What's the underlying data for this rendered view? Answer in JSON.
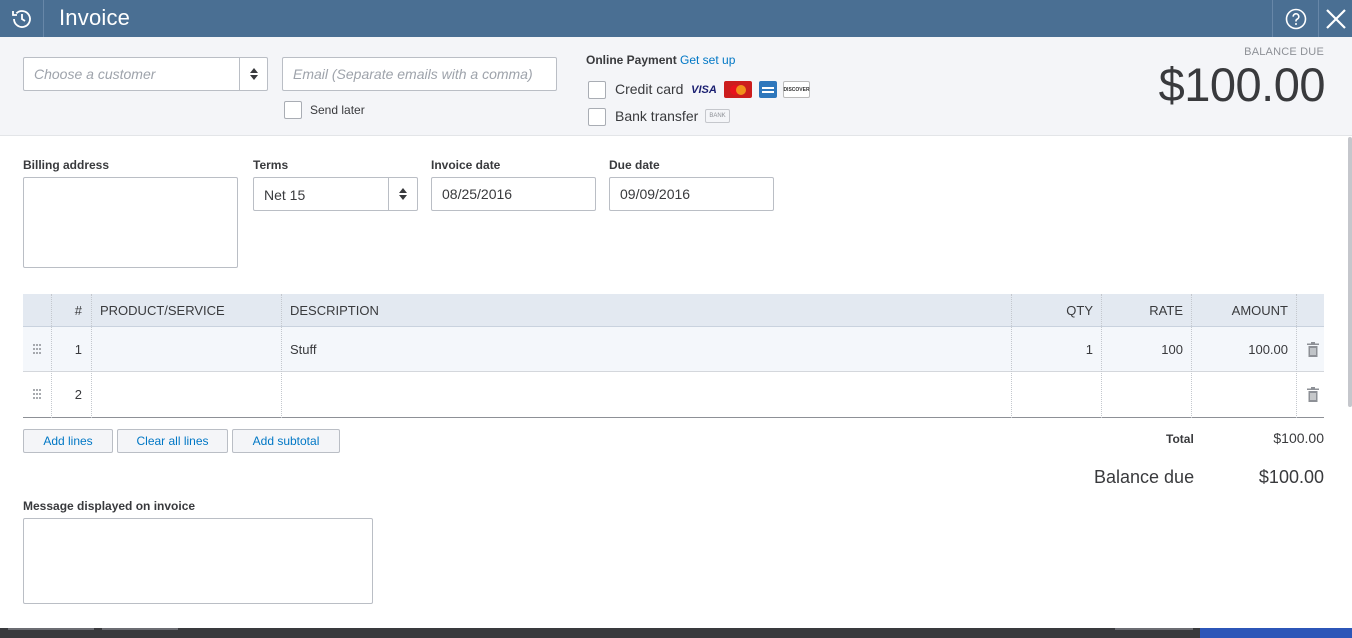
{
  "header": {
    "title": "Invoice",
    "logo_icon": "recurring-clock-icon",
    "help_icon": "help-circle-icon",
    "close_icon": "close-icon"
  },
  "customer": {
    "placeholder": "Choose a customer",
    "value": ""
  },
  "email": {
    "placeholder": "Email (Separate emails with a comma)",
    "value": "",
    "send_later_label": "Send later",
    "send_later_checked": false
  },
  "online_payment": {
    "title": "Online Payment",
    "link": "Get set up",
    "credit_card_label": "Credit card",
    "credit_card_checked": false,
    "bank_transfer_label": "Bank transfer",
    "bank_transfer_checked": false,
    "cards": [
      {
        "name": "VISA",
        "color": "#1a1f71"
      },
      {
        "name": "MasterCard",
        "color": "#eb6d1c"
      },
      {
        "name": "AMEX",
        "color": "#2e77bc"
      },
      {
        "name": "DISCOVER",
        "color": "#f47216"
      }
    ],
    "bank_badge": "BANK"
  },
  "balance": {
    "label": "BALANCE DUE",
    "amount": "$100.00"
  },
  "billing": {
    "label": "Billing address",
    "value": ""
  },
  "terms": {
    "label": "Terms",
    "value": "Net 15"
  },
  "invoice_date": {
    "label": "Invoice date",
    "value": "08/25/2016"
  },
  "due_date": {
    "label": "Due date",
    "value": "09/09/2016"
  },
  "table": {
    "headers": {
      "num": "#",
      "product": "PRODUCT/SERVICE",
      "description": "DESCRIPTION",
      "qty": "QTY",
      "rate": "RATE",
      "amount": "AMOUNT"
    },
    "rows": [
      {
        "num": "1",
        "product": "",
        "description": "Stuff",
        "qty": "1",
        "rate": "100",
        "amount": "100.00"
      },
      {
        "num": "2",
        "product": "",
        "description": "",
        "qty": "",
        "rate": "",
        "amount": ""
      }
    ]
  },
  "buttons": {
    "add_lines": "Add lines",
    "clear_all": "Clear all lines",
    "add_subtotal": "Add subtotal"
  },
  "totals": {
    "total_label": "Total",
    "total_value": "$100.00",
    "balance_due_label": "Balance due",
    "balance_due_value": "$100.00"
  },
  "message": {
    "label": "Message displayed on invoice",
    "value": ""
  },
  "colors": {
    "header": "#4a6f93",
    "link": "#0077c5",
    "table_header": "#e3e9f1"
  }
}
